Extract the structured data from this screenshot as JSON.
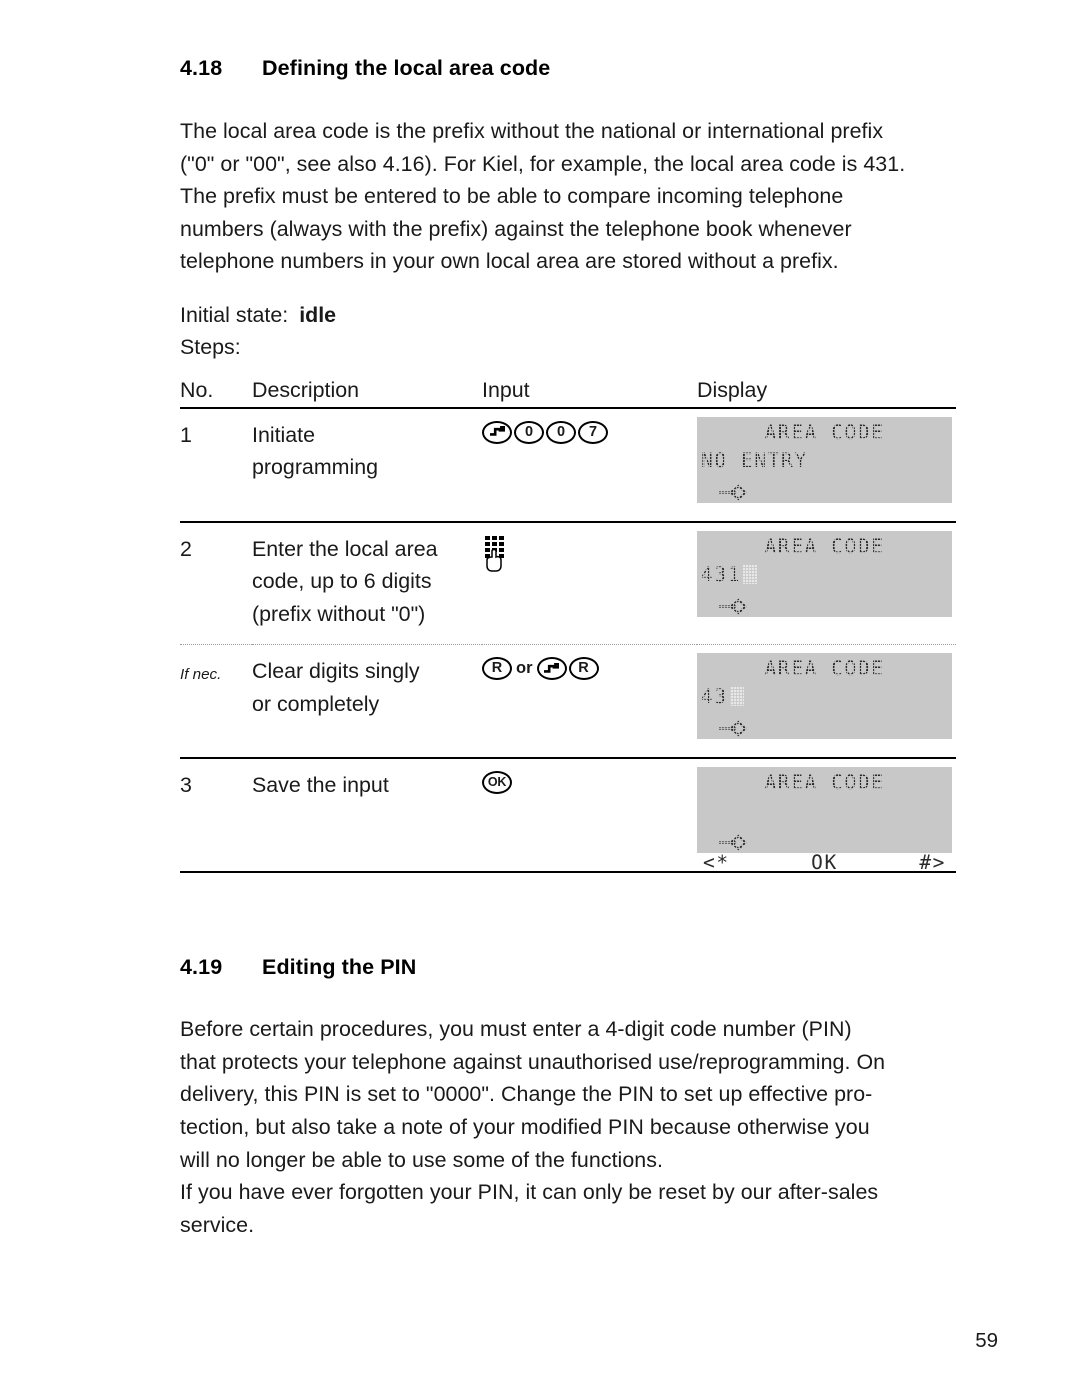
{
  "sections": [
    {
      "number": "4.18",
      "title": "Defining the local area code",
      "paragraph_lines": [
        "The local area code is the prefix without the national or international prefix",
        "(\"0\" or \"00\", see also 4.16). For Kiel, for example, the local area code is 431.",
        "The prefix must be entered to be able to compare incoming telephone",
        "numbers (always with the prefix) against the telephone book whenever",
        "telephone numbers in your own local area are stored without a prefix."
      ],
      "initial_state_label": "Initial state:",
      "initial_state_value": "idle",
      "steps_label": "Steps:"
    },
    {
      "number": "4.19",
      "title": "Editing the PIN",
      "paragraph_lines": [
        "Before certain procedures, you must enter a 4-digit code number (PIN)",
        "that protects your telephone against unauthorised use/reprogramming. On",
        "delivery, this PIN is set to \"0000\". Change the PIN to set up effective pro-",
        "tection, but also take a note of your modified PIN because otherwise you",
        "will no longer be able to use some of the functions."
      ],
      "paragraph2_lines": [
        "If you have ever forgotten your PIN, it can only be reset by our after-sales",
        "service."
      ]
    }
  ],
  "table": {
    "headers": {
      "no": "No.",
      "description": "Description",
      "input": "Input",
      "display": "Display"
    },
    "rows": [
      {
        "no": "1",
        "description_lines": [
          "Initiate",
          "programming"
        ],
        "input_keys": [
          "program-key",
          "0",
          "0",
          "7"
        ],
        "display": {
          "line1": "AREA CODE",
          "line2": "NO ENTRY",
          "line2_cursor": false,
          "line3_arrow": true
        },
        "divider": "solid"
      },
      {
        "no": "2",
        "description_lines": [
          "Enter the local area",
          "code, up to 6 digits",
          "(prefix without \"0\")"
        ],
        "input_keys": [
          "keypad-icon"
        ],
        "display": {
          "line1": "AREA CODE",
          "line2": "431",
          "line2_cursor": true,
          "line3_arrow": true
        },
        "divider": "dotted"
      },
      {
        "no": "If nec.",
        "no_italic": true,
        "description_lines": [
          "Clear digits singly",
          "or completely"
        ],
        "input_keys": [
          "R",
          "or",
          "program-key",
          "R"
        ],
        "display": {
          "line1": "AREA CODE",
          "line2": "43",
          "line2_cursor": true,
          "line3_arrow": true
        },
        "divider": "solid"
      },
      {
        "no": "3",
        "description_lines": [
          "Save the input"
        ],
        "input_keys": [
          "OK"
        ],
        "display": {
          "line1": "AREA CODE",
          "line2_left": "<*",
          "line2_center": "OK",
          "line2_right": "#>",
          "line2_cursor": false,
          "line3_arrow": true
        },
        "divider": "solid"
      }
    ],
    "or_label": "or"
  },
  "page_number": "59",
  "colors": {
    "lcd_background": "#c8c8c8",
    "lcd_text": "#2b2b2b",
    "text": "#1a1a1a",
    "rule": "#000000"
  }
}
